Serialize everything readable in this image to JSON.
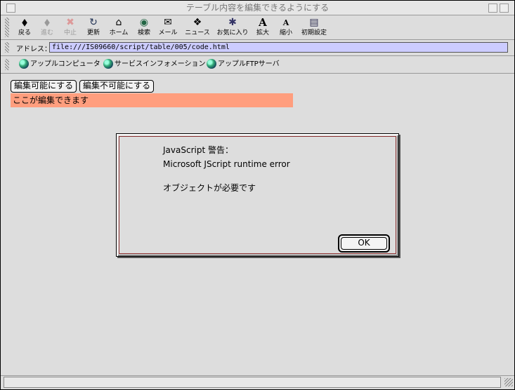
{
  "window": {
    "title": "テーブル内容を編集できるようにする"
  },
  "toolbar": {
    "buttons": [
      {
        "label": "戻る",
        "icon": "◆",
        "enabled": true
      },
      {
        "label": "進む",
        "icon": "◆",
        "enabled": false
      },
      {
        "label": "中止",
        "icon": "✖",
        "enabled": false
      },
      {
        "label": "更新",
        "icon": "↻",
        "enabled": true
      },
      {
        "label": "ホーム",
        "icon": "⌂",
        "enabled": true
      },
      {
        "label": "検索",
        "icon": "◉",
        "enabled": true
      },
      {
        "label": "メール",
        "icon": "✉",
        "enabled": true
      },
      {
        "label": "ニュース",
        "icon": "❖",
        "enabled": true
      },
      {
        "label": "お気に入り",
        "icon": "✱",
        "enabled": true
      },
      {
        "label": "拡大",
        "icon": "A",
        "enabled": true
      },
      {
        "label": "縮小",
        "icon": "A",
        "enabled": true
      },
      {
        "label": "初期設定",
        "icon": "▤",
        "enabled": true
      }
    ]
  },
  "address": {
    "label": "アドレス：",
    "value": "file:///IS09660/script/table/005/code.html"
  },
  "favorites": [
    {
      "label": "アップルコンピュータ"
    },
    {
      "label": "サービスインフォメーション"
    },
    {
      "label": "アップルFTPサーバ"
    }
  ],
  "page": {
    "btn_editable": "編集可能にする",
    "btn_not_editable": "編集不可能にする",
    "editable_text": "ここが編集できます"
  },
  "dialog": {
    "title": "JavaScript 警告：",
    "line1": "Microsoft JScript runtime error",
    "line2": "オブジェクトが必要です",
    "ok_label": "OK"
  },
  "colors": {
    "address_bg": "#ccccff",
    "editable_bg": "#ff9e7e",
    "dialog_border": "#8a3030"
  }
}
